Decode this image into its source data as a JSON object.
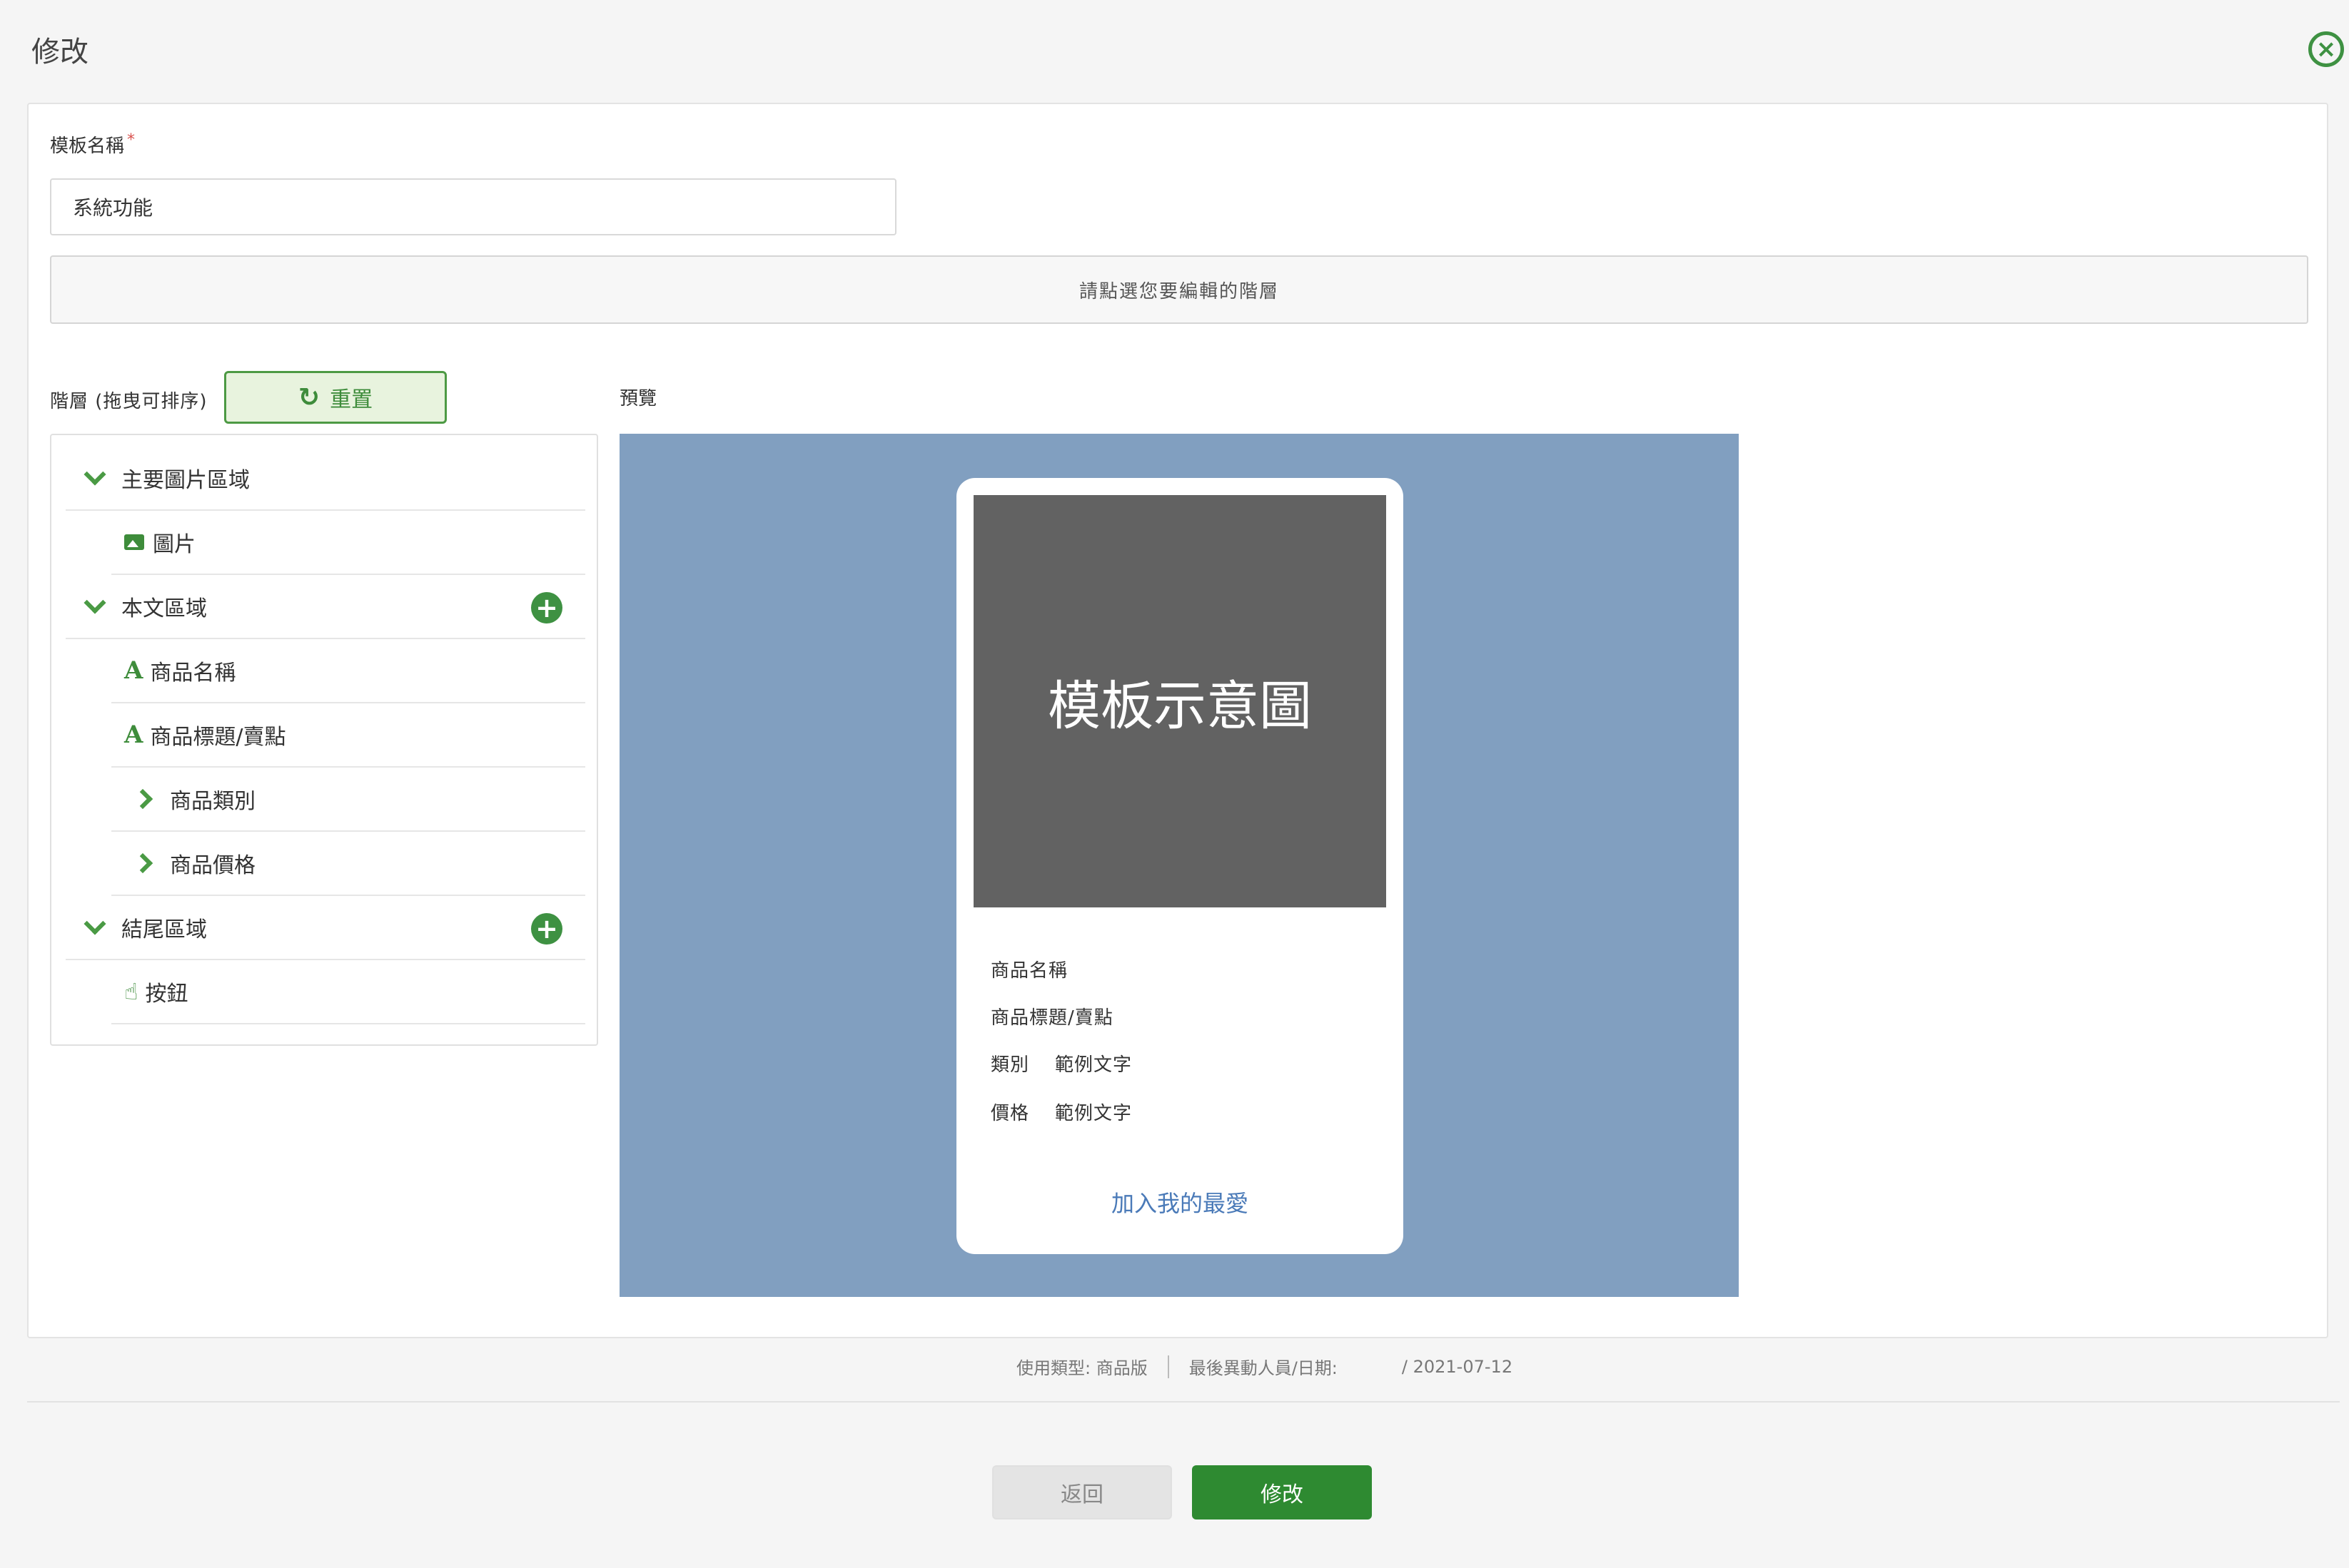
{
  "header": {
    "title": "修改",
    "close_icon": "⊗"
  },
  "form": {
    "template_name_label": "模板名稱",
    "required_mark": "*",
    "template_name_value": "系統功能",
    "hint": "請點選您要編輯的階層"
  },
  "layers": {
    "label": "階層 (拖曳可排序)",
    "reset_label": "重置",
    "items": [
      {
        "label": "主要圖片區域"
      },
      {
        "label": "圖片"
      },
      {
        "label": "本文區域"
      },
      {
        "label": "商品名稱"
      },
      {
        "label": "商品標題/賣點"
      },
      {
        "label": "商品類別"
      },
      {
        "label": "商品價格"
      },
      {
        "label": "結尾區域"
      },
      {
        "label": "按鈕"
      }
    ]
  },
  "preview": {
    "label": "預覽",
    "image_text": "模板示意圖",
    "product_name": "商品名稱",
    "product_title": "商品標題/賣點",
    "category_label": "類別",
    "category_value": "範例文字",
    "price_label": "價格",
    "price_value": "範例文字",
    "favorite_link": "加入我的最愛"
  },
  "meta": {
    "usage_type": "使用類型: 商品版",
    "last_modified_label": "最後異動人員/日期:",
    "last_modified_value": "/ 2021-07-12"
  },
  "actions": {
    "back_label": "返回",
    "submit_label": "修改"
  },
  "colors": {
    "accent": "#3e9142",
    "preview_bg": "#819fc0",
    "image_bg": "#626262",
    "link": "#4a7ab8"
  }
}
